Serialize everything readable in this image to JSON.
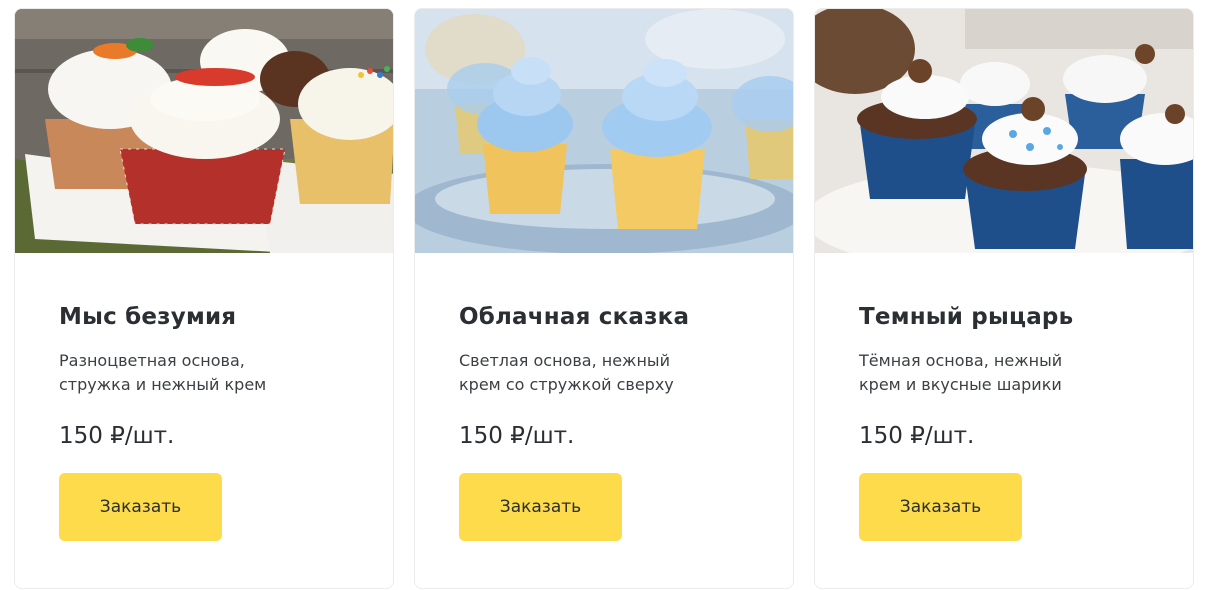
{
  "products": [
    {
      "title": "Мыс безумия",
      "desc_line1": "Разноцветная основа,",
      "desc_line2": "стружка и нежный крем",
      "price": "150 ₽/шт.",
      "button": "Заказать"
    },
    {
      "title": "Облачная сказка",
      "desc_line1": "Светлая основа, нежный",
      "desc_line2": "крем со стружкой сверху",
      "price": "150 ₽/шт.",
      "button": "Заказать"
    },
    {
      "title": "Темный рыцарь",
      "desc_line1": "Тёмная основа, нежный",
      "desc_line2": "крем и вкусные шарики",
      "price": "150 ₽/шт.",
      "button": "Заказать"
    }
  ],
  "colors": {
    "button_bg": "#fddb4a",
    "text": "#2b2f33",
    "card_border": "#ececec"
  }
}
